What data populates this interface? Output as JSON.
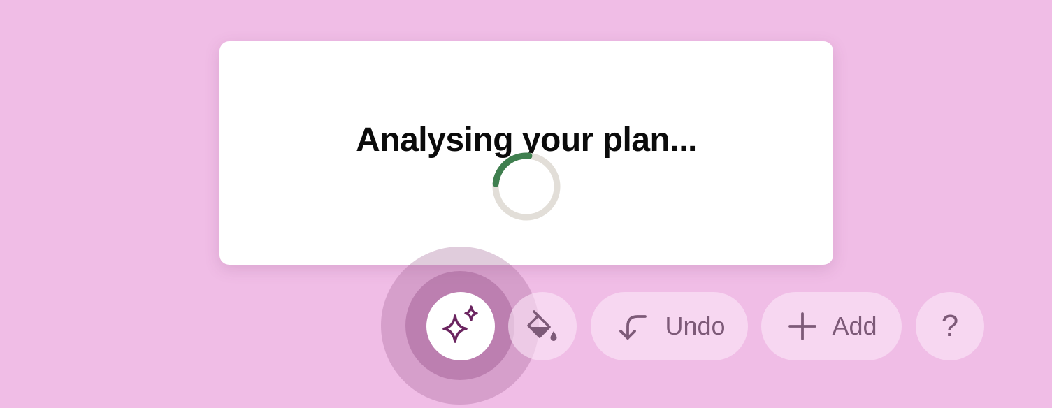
{
  "modal": {
    "title": "Analysing your plan...",
    "loading_progress": 0.25
  },
  "toolbar": {
    "ai_icon": "sparkles-icon",
    "paint_icon": "paint-bucket-icon",
    "undo_icon": "undo-arrow-icon",
    "undo_label": "Undo",
    "add_icon": "plus-icon",
    "add_label": "Add",
    "help_label": "?"
  },
  "colors": {
    "background": "#f0bde6",
    "spinner_track": "#e2ded8",
    "spinner_arc": "#3f7f4f",
    "ai_icon": "#6b2560",
    "toolbar_icon": "#7d5a78"
  }
}
